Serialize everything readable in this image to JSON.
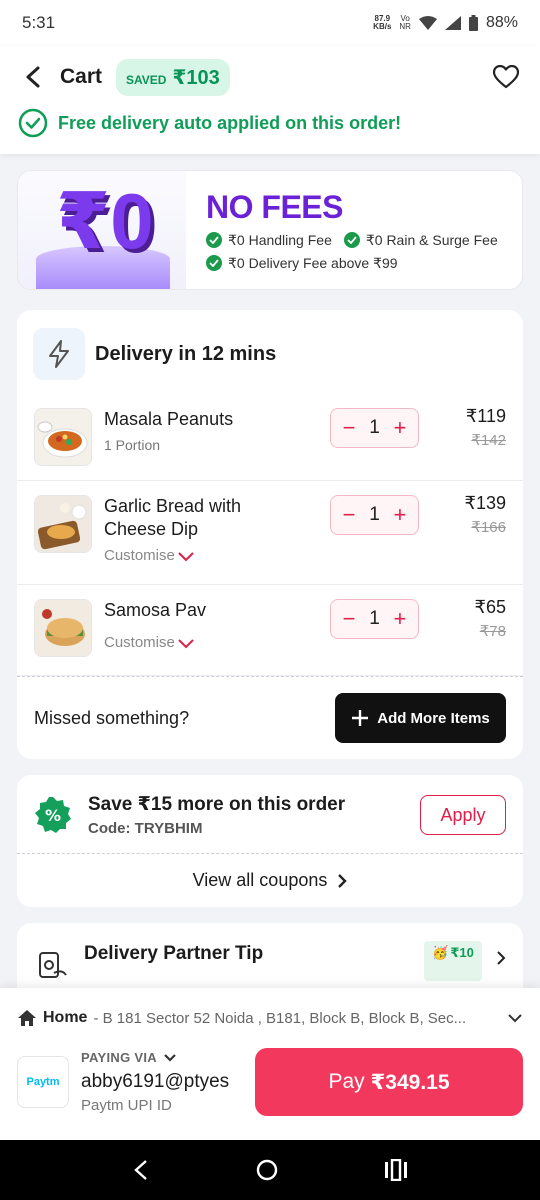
{
  "status_bar": {
    "time": "5:31",
    "net_speed": "87.9",
    "net_unit": "KB/s",
    "net_type_top": "Vo",
    "net_type_bottom": "NR",
    "battery": "88%"
  },
  "header": {
    "title": "Cart",
    "saved_label": "SAVED",
    "saved_amount": "₹103",
    "free_delivery_text": "Free delivery auto applied on this order!"
  },
  "no_fees": {
    "big_text": "₹0",
    "title": "NO FEES",
    "fees": [
      "₹0 Handling Fee",
      "₹0 Rain & Surge Fee",
      "₹0 Delivery Fee above ₹99"
    ]
  },
  "delivery": {
    "title": "Delivery in 12 mins",
    "items": [
      {
        "name": "Masala Peanuts",
        "sub": "1 Portion",
        "qty": "1",
        "price": "₹119",
        "mrp": "₹142"
      },
      {
        "name": "Garlic Bread with Cheese Dip",
        "sub": "Customise",
        "qty": "1",
        "price": "₹139",
        "mrp": "₹166"
      },
      {
        "name": "Samosa Pav",
        "sub": "Customise",
        "qty": "1",
        "price": "₹65",
        "mrp": "₹78"
      }
    ],
    "missed_text": "Missed something?",
    "add_more_label": "Add More Items"
  },
  "coupon": {
    "title": "Save ₹15 more on this order",
    "code": "Code: TRYBHIM",
    "apply_label": "Apply",
    "view_all_label": "View all coupons"
  },
  "tip": {
    "title": "Delivery Partner Tip",
    "tag": "₹10"
  },
  "checkout": {
    "address_label": "Home",
    "address": "- B 181 Sector 52 Noida , B181, Block B, Block B, Sec...",
    "paying_via_label": "PAYING VIA",
    "payment_logo": "Paytm",
    "payment_id": "abby6191@ptyes",
    "payment_type": "Paytm UPI ID",
    "pay_label": "Pay",
    "pay_amount": "₹349.15"
  },
  "colors": {
    "accent": "#f2385d",
    "green": "#0f9d58",
    "purple": "#6b21d6"
  }
}
